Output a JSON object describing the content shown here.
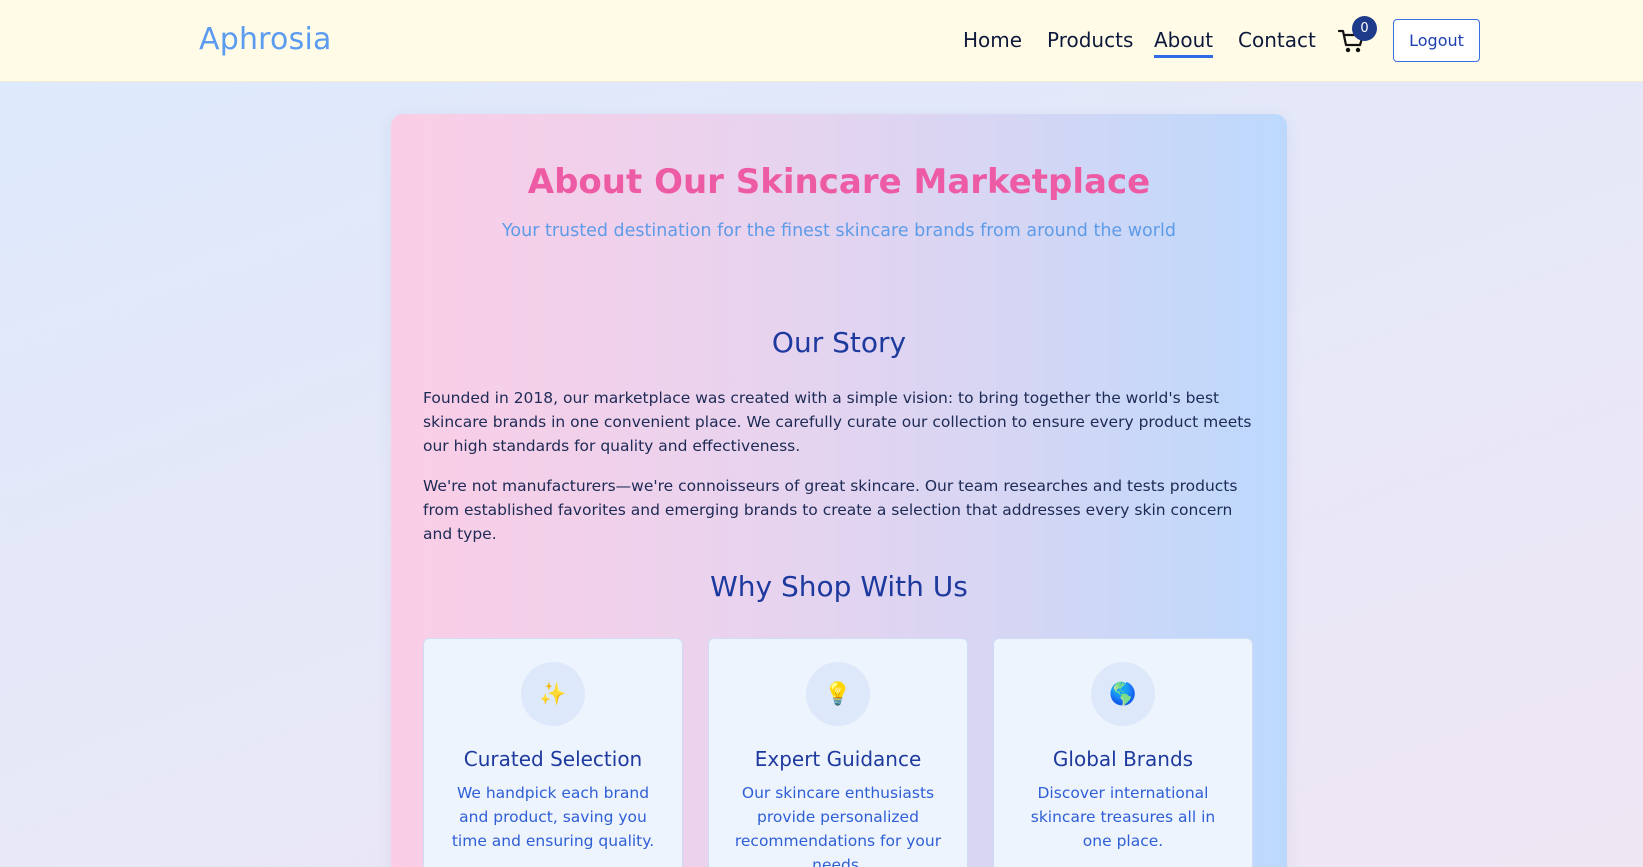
{
  "header": {
    "brand": "Aphrosia",
    "nav": {
      "home": "Home",
      "products": "Products",
      "about": "About",
      "contact": "Contact"
    },
    "cart_count": "0",
    "logout_label": "Logout"
  },
  "about": {
    "title": "About Our Skincare Marketplace",
    "subtitle": "Your trusted destination for the finest skincare brands from around the world",
    "story_heading": "Our Story",
    "story_p1": "Founded in 2018, our marketplace was created with a simple vision: to bring together the world's best skincare brands in one convenient place. We carefully curate our collection to ensure every product meets our high standards for quality and effectiveness.",
    "story_p2": "We're not manufacturers—we're connoisseurs of great skincare. Our team researches and tests products from established favorites and emerging brands to create a selection that addresses every skin concern and type.",
    "why_heading": "Why Shop With Us",
    "features": [
      {
        "icon": "sparkles-icon",
        "glyph": "✨",
        "title": "Curated Selection",
        "desc": "We handpick each brand and product, saving you time and ensuring quality."
      },
      {
        "icon": "lightbulb-icon",
        "glyph": "💡",
        "title": "Expert Guidance",
        "desc": "Our skincare enthusiasts provide personalized recommendations for your needs."
      },
      {
        "icon": "globe-icon",
        "glyph": "🌎",
        "title": "Global Brands",
        "desc": "Discover international skincare treasures all in one place."
      }
    ]
  },
  "colors": {
    "brand": "#5b9bf0",
    "title_pink": "#ee5ba5",
    "heading_blue": "#1e3a9e",
    "badge": "#1e3a8a"
  }
}
